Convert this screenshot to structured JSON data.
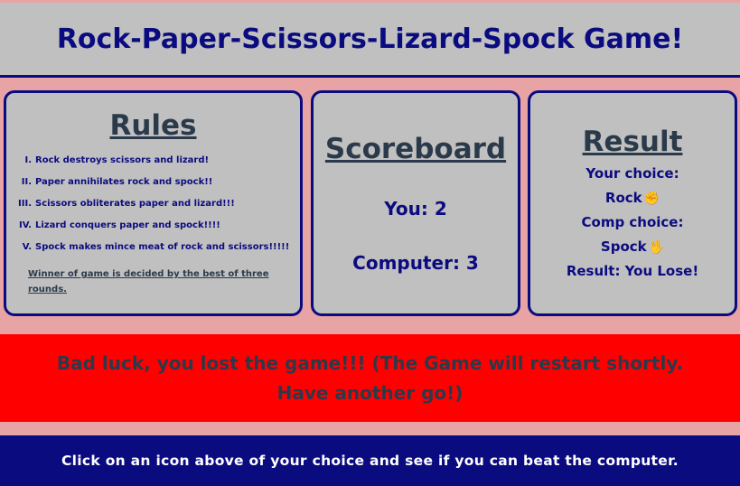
{
  "header": {
    "title": "Rock-Paper-Scissors-Lizard-Spock Game!"
  },
  "rules": {
    "title": "Rules",
    "items": [
      {
        "num": "I.",
        "text": "Rock destroys scissors and lizard!"
      },
      {
        "num": "II.",
        "text": "Paper annihilates rock and spock!!"
      },
      {
        "num": "III.",
        "text": "Scissors obliterates paper and lizard!!!"
      },
      {
        "num": "IV.",
        "text": "Lizard conquers paper and spock!!!!"
      },
      {
        "num": "V.",
        "text": "Spock makes mince meat of rock and scissors!!!!!"
      }
    ],
    "note": "Winner of game is decided by the best of three rounds."
  },
  "scoreboard": {
    "title": "Scoreboard",
    "you": "You: 2",
    "computer": "Computer: 3"
  },
  "result": {
    "title": "Result",
    "your_choice_label": "Your choice:",
    "your_choice_value": "Rock",
    "your_choice_icon": "✊",
    "comp_choice_label": "Comp choice:",
    "comp_choice_value": "Spock",
    "comp_choice_icon": "🖖",
    "outcome": "Result: You Lose!"
  },
  "banner": {
    "message": "Bad luck, you lost the game!!! (The Game will restart shortly. Have another go!)"
  },
  "footer": {
    "instruction": "Click on an icon above of your choice and see if you can beat the computer."
  },
  "colors": {
    "background": "#e8a4a4",
    "panel": "#c0c0c0",
    "navy": "#0b0b80",
    "banner": "#ff0000"
  }
}
